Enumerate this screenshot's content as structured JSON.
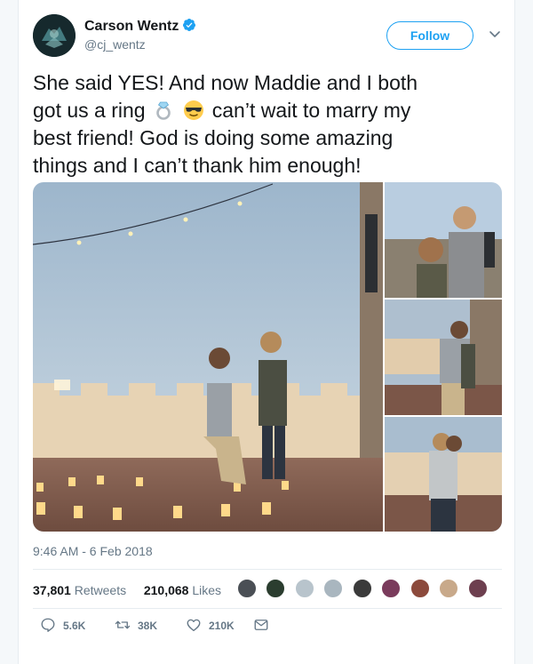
{
  "user": {
    "display_name": "Carson Wentz",
    "handle": "@cj_wentz",
    "verified": true,
    "follow_label": "Follow"
  },
  "tweet": {
    "text_line1": "She said YES! And now Maddie and I both",
    "text_line2_before": "got us a ring",
    "text_line2_after": "can’t wait to marry my",
    "text_line3": "best friend! God is doing some amazing",
    "text_line4": "things and I can’t thank him enough!",
    "emojis": [
      "ring-emoji",
      "sunglasses-emoji"
    ],
    "timestamp": "9:46 AM - 6 Feb 2018"
  },
  "stats": {
    "retweets_count": "37,801",
    "retweets_label": "Retweets",
    "likes_count": "210,068",
    "likes_label": "Likes"
  },
  "actions": {
    "reply_count": "5.6K",
    "retweet_count": "38K",
    "like_count": "210K"
  },
  "colors": {
    "accent": "#1da1f2",
    "text_primary": "#14171a",
    "text_secondary": "#657786",
    "divider": "#e6ecf0"
  },
  "icons": [
    "verified-badge-icon",
    "chevron-down-icon",
    "reply-icon",
    "retweet-icon",
    "like-icon",
    "message-icon"
  ]
}
